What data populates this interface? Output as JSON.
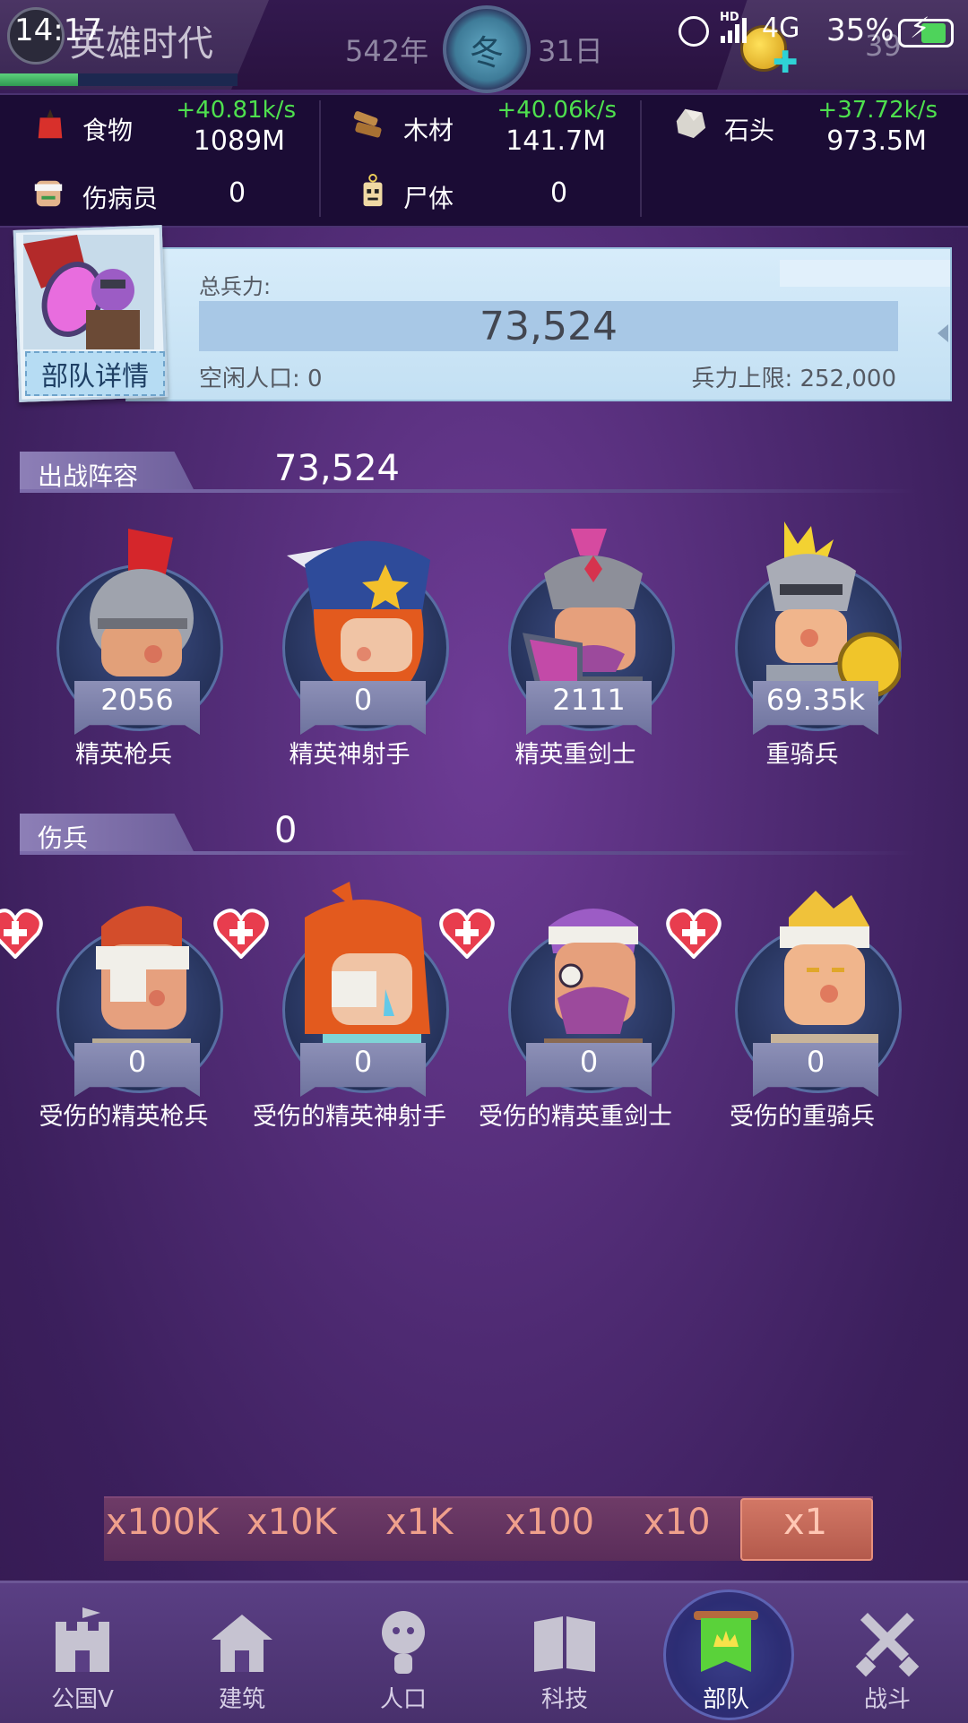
{
  "status_bar": {
    "time": "14:17",
    "hd": "HD",
    "network": "4G",
    "battery": "35%"
  },
  "header": {
    "title": "英雄时代",
    "year": "542年",
    "season": "冬",
    "day": "31日",
    "level": "39",
    "xp_progress_fraction": 0.33
  },
  "resources": {
    "food": {
      "label": "食物",
      "rate": "+40.81k/s",
      "value": "1089M",
      "icon": "apple-icon"
    },
    "wood": {
      "label": "木材",
      "rate": "+40.06k/s",
      "value": "141.7M",
      "icon": "wood-icon"
    },
    "stone": {
      "label": "石头",
      "rate": "+37.72k/s",
      "value": "973.5M",
      "icon": "stone-icon"
    },
    "wounded": {
      "label": "伤病员",
      "value": "0",
      "icon": "bandaged-face-icon"
    },
    "corpse": {
      "label": "尸体",
      "value": "0",
      "icon": "zombie-icon"
    }
  },
  "army": {
    "details_button": "部队详情",
    "total_label": "总兵力:",
    "total_value": "73,524",
    "idle_label": "空闲人口: 0",
    "limit_label": "兵力上限: 252,000"
  },
  "deployed": {
    "title": "出战阵容",
    "value": "73,524",
    "units": [
      {
        "name": "精英枪兵",
        "count": "2056"
      },
      {
        "name": "精英神射手",
        "count": "0"
      },
      {
        "name": "精英重剑士",
        "count": "2111"
      },
      {
        "name": "重骑兵",
        "count": "69.35k"
      }
    ]
  },
  "wounded_section": {
    "title": "伤兵",
    "value": "0",
    "units": [
      {
        "name": "受伤的精英枪兵",
        "count": "0"
      },
      {
        "name": "受伤的精英神射手",
        "count": "0"
      },
      {
        "name": "受伤的精英重剑士",
        "count": "0"
      },
      {
        "name": "受伤的重骑兵",
        "count": "0"
      }
    ]
  },
  "multipliers": [
    "x100K",
    "x10K",
    "x1K",
    "x100",
    "x10",
    "x1"
  ],
  "multiplier_selected": "x1",
  "nav": [
    {
      "label": "公国V",
      "icon": "castle-icon"
    },
    {
      "label": "建筑",
      "icon": "house-icon"
    },
    {
      "label": "人口",
      "icon": "person-icon"
    },
    {
      "label": "科技",
      "icon": "book-icon"
    },
    {
      "label": "部队",
      "icon": "banner-icon",
      "active": true
    },
    {
      "label": "战斗",
      "icon": "crossed-swords-icon"
    }
  ],
  "colors": {
    "rate_green": "#4ee04e",
    "bg_purple": "#4e2a72",
    "active_mult": "#c86b5c"
  }
}
